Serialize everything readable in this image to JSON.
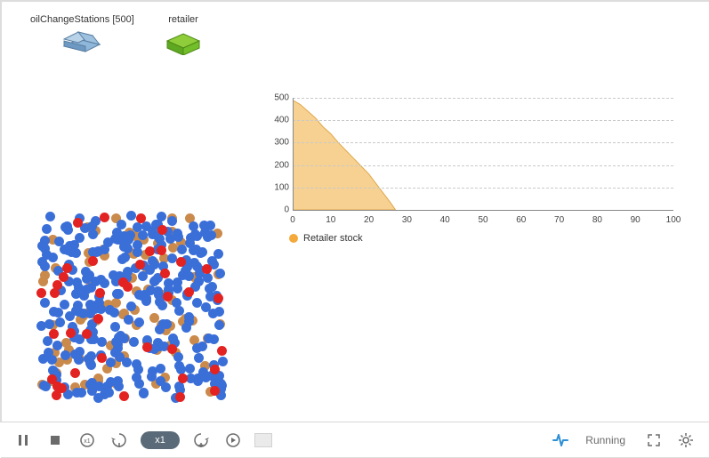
{
  "agents": {
    "oilChangeStations": {
      "label": "oilChangeStations [500]"
    },
    "retailer": {
      "label": "retailer"
    }
  },
  "chart_data": {
    "type": "area",
    "title": "",
    "xlabel": "",
    "ylabel": "",
    "xlim": [
      0,
      100
    ],
    "ylim": [
      0,
      500
    ],
    "xticks": [
      0,
      10,
      20,
      30,
      40,
      50,
      60,
      70,
      80,
      90,
      100
    ],
    "yticks": [
      0,
      100,
      200,
      300,
      400,
      500
    ],
    "series": [
      {
        "name": "Retailer stock",
        "color": "#f5c97e",
        "x": [
          0,
          2,
          4,
          6,
          8,
          10,
          12,
          14,
          16,
          18,
          20,
          22,
          24,
          26,
          27
        ],
        "values": [
          490,
          470,
          440,
          410,
          370,
          340,
          300,
          265,
          230,
          195,
          160,
          115,
          70,
          25,
          0
        ]
      }
    ],
    "legend": {
      "marker_color": "#f4a93a",
      "label": "Retailer stock"
    }
  },
  "controls": {
    "speed_label": "x1",
    "status": "Running"
  },
  "scatter": {
    "colors": {
      "blue": "#3a6fd8",
      "orange": "#ca8a4b",
      "red": "#e32222"
    },
    "approx_counts": {
      "blue": 300,
      "orange": 90,
      "red": 40
    }
  }
}
